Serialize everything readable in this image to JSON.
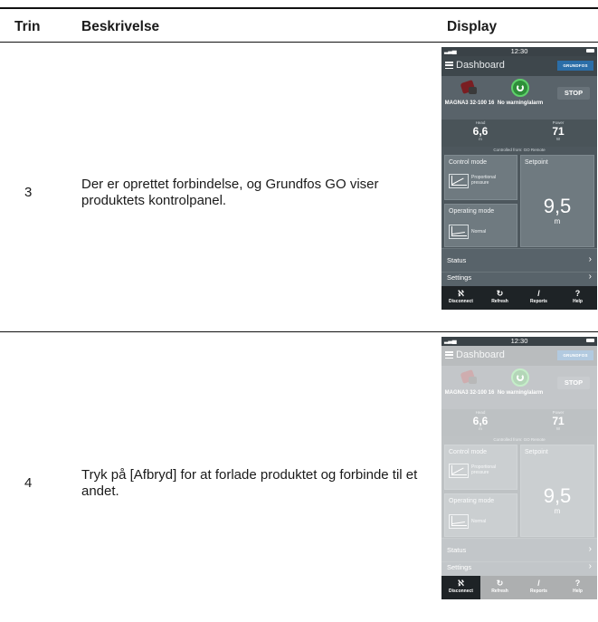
{
  "table": {
    "headers": {
      "step": "Trin",
      "description": "Beskrivelse",
      "display": "Display"
    },
    "rows": [
      {
        "step": "3",
        "description": "Der er oprettet forbindelse, og Grundfos GO viser produktets kontrolpanel."
      },
      {
        "step": "4",
        "description": "Tryk på [Afbryd] for at forlade produktet og forbinde til et andet."
      }
    ]
  },
  "phone": {
    "status_bar": {
      "time": "12:30"
    },
    "header": {
      "title": "Dashboard",
      "logo": "GRUNDFOS"
    },
    "product": {
      "name": "MAGNA3 32-100 16",
      "warning": "No warning/alarm",
      "stop_label": "STOP"
    },
    "measurements": {
      "head": {
        "label": "Head",
        "value": "6,6",
        "unit": "m"
      },
      "power": {
        "label": "Power",
        "value": "71",
        "unit": "W"
      }
    },
    "controlled_from": "Controlled from: GO Remote",
    "control_mode": {
      "label": "Control mode",
      "value": "Proportional pressure"
    },
    "operating_mode": {
      "label": "Operating mode",
      "value": "Normal"
    },
    "setpoint": {
      "label": "Setpoint",
      "value": "9,5",
      "unit": "m"
    },
    "menu_rows": [
      "Status",
      "Settings"
    ],
    "bottom_nav": [
      {
        "icon": "disconnect-icon",
        "label": "Disconnect"
      },
      {
        "icon": "refresh-icon",
        "label": "Refresh"
      },
      {
        "icon": "reports-icon",
        "label": "Reports"
      },
      {
        "icon": "help-icon",
        "label": "Help"
      }
    ]
  }
}
